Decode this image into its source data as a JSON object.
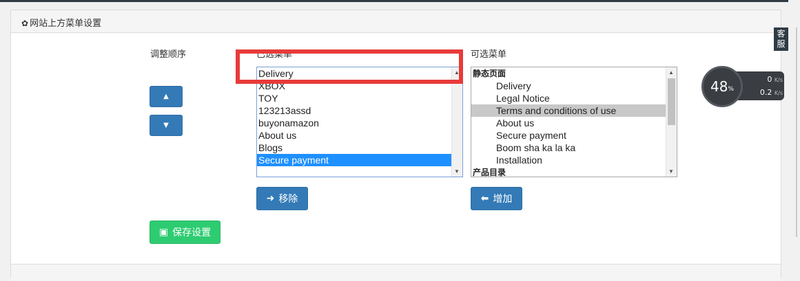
{
  "panel": {
    "title": "网站上方菜单设置"
  },
  "labels": {
    "adjust_order": "调整顺序",
    "selected_menu": "已选菜单",
    "available_menu": "可选菜单"
  },
  "selected_list": {
    "items": [
      "Delivery",
      "XBOX",
      "TOY",
      "123213assd",
      "buyonamazon",
      "About us",
      "Blogs",
      "Secure payment"
    ],
    "selected": "Secure payment"
  },
  "available_list": {
    "group1": "静态页面",
    "items": [
      "Delivery",
      "Legal Notice",
      "Terms and conditions of use",
      "About us",
      "Secure payment",
      "Boom sha ka la ka",
      "Installation"
    ],
    "highlighted": "Terms and conditions of use",
    "group2": "产品目录"
  },
  "buttons": {
    "up": "▲",
    "down": "▼",
    "remove": "移除",
    "add": "增加",
    "save": "保存设置"
  },
  "icons": {
    "heading": "gear-icon",
    "up": "chevron-up-icon",
    "down": "chevron-down-icon",
    "remove": "arrow-right-icon",
    "add": "arrow-left-icon",
    "save": "floppy-disk-icon"
  },
  "side_tab": {
    "label": "客服"
  },
  "speed_widget": {
    "percent": "48",
    "percent_sign": "%",
    "upload": "0",
    "download": "0.2",
    "unit": "K/s"
  },
  "colors": {
    "highlight": "#e83a3a",
    "primary": "#337ab7",
    "success": "#2ecc71",
    "selected": "#1e90ff"
  }
}
